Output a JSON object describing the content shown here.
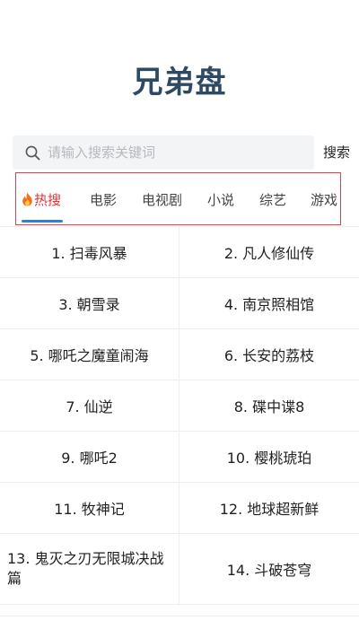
{
  "app": {
    "title": "兄弟盘"
  },
  "search": {
    "placeholder": "请输入搜索关键词",
    "button_label": "搜索"
  },
  "tabs": [
    {
      "label": "热搜",
      "active": true,
      "icon": "fire-icon"
    },
    {
      "label": "电影",
      "active": false
    },
    {
      "label": "电视剧",
      "active": false
    },
    {
      "label": "小说",
      "active": false
    },
    {
      "label": "综艺",
      "active": false
    },
    {
      "label": "游戏",
      "active": false
    }
  ],
  "colors": {
    "title": "#2c4a63",
    "active_tab": "#e0363c",
    "underline": "#2f7fe0",
    "highlight_frame": "#d9434e"
  },
  "hot_list": [
    "1. 扫毒风暴",
    "2. 凡人修仙传",
    "3. 朝雪录",
    "4. 南京照相馆",
    "5. 哪吒之魔童闹海",
    "6. 长安的荔枝",
    "7. 仙逆",
    "8. 碟中谍8",
    "9. 哪吒2",
    "10. 樱桃琥珀",
    "11. 牧神记",
    "12. 地球超新鲜",
    "13. 鬼灭之刃无限城决战篇",
    "14. 斗破苍穹"
  ]
}
